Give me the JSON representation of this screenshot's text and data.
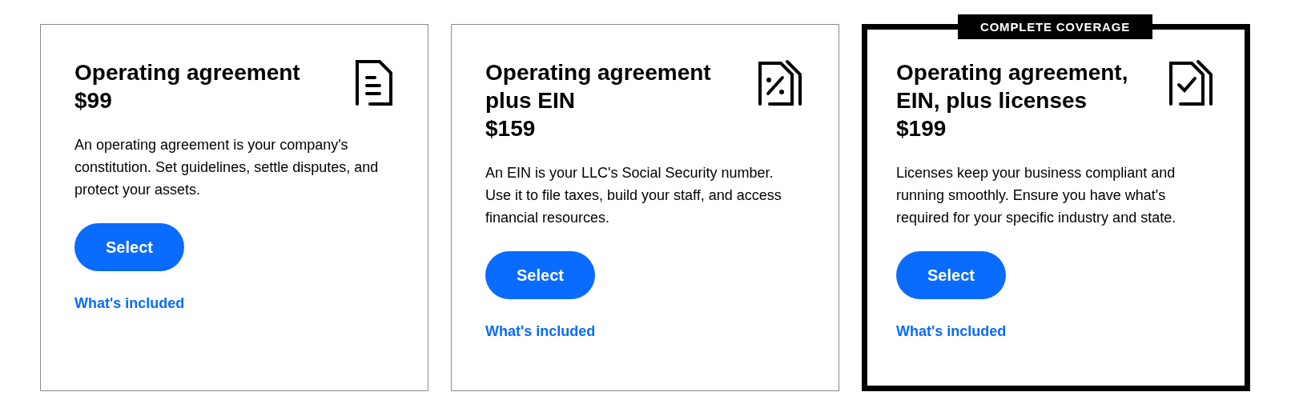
{
  "plans": [
    {
      "kind": "document",
      "featured": false,
      "title": "Operating agreement",
      "price": "$99",
      "description": "An operating agreement is your company's constitution. Set guidelines, settle disputes, and protect your assets.",
      "button": "Select",
      "link": "What's included"
    },
    {
      "kind": "percent",
      "featured": false,
      "title": "Operating agreement plus EIN",
      "price": "$159",
      "description": "An EIN is your LLC's Social Security number. Use it to file taxes, build your staff, and access financial resources.",
      "button": "Select",
      "link": "What's included"
    },
    {
      "kind": "check",
      "featured": true,
      "badge": "COMPLETE COVERAGE",
      "title": "Operating agreement, EIN, plus licenses",
      "price": "$199",
      "description": "Licenses keep your business compliant and running smoothly. Ensure you have what's required for your specific industry and state.",
      "button": "Select",
      "link": "What's included"
    }
  ]
}
